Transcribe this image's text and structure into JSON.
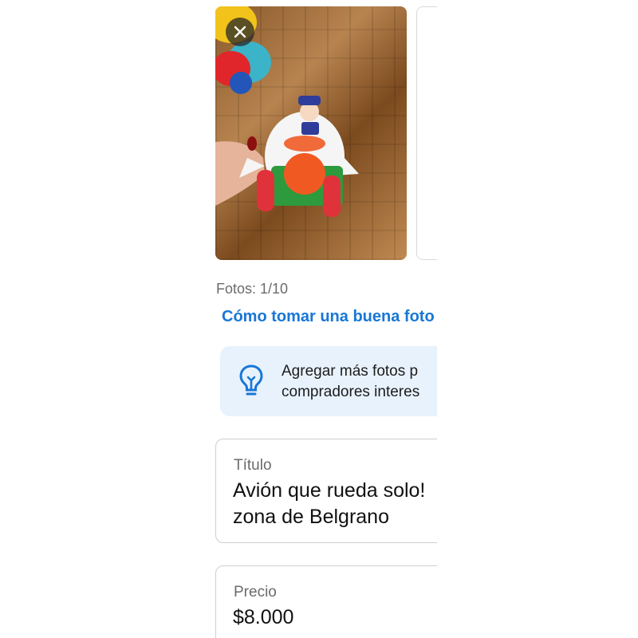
{
  "photos": {
    "count_label": "Fotos: 1/10",
    "tips_link": "Cómo tomar una buena foto"
  },
  "tip": {
    "icon": "lightbulb-icon",
    "line1": "Agregar más fotos p",
    "line2": "compradores interes"
  },
  "title_field": {
    "label": "Título",
    "value_line1": "Avión que rueda solo!",
    "value_line2": "zona de Belgrano"
  },
  "price_field": {
    "label": "Precio",
    "value": "$8.000"
  },
  "colors": {
    "link": "#1877d6",
    "tip_background": "#e8f2fd",
    "tip_icon": "#1877d6"
  }
}
